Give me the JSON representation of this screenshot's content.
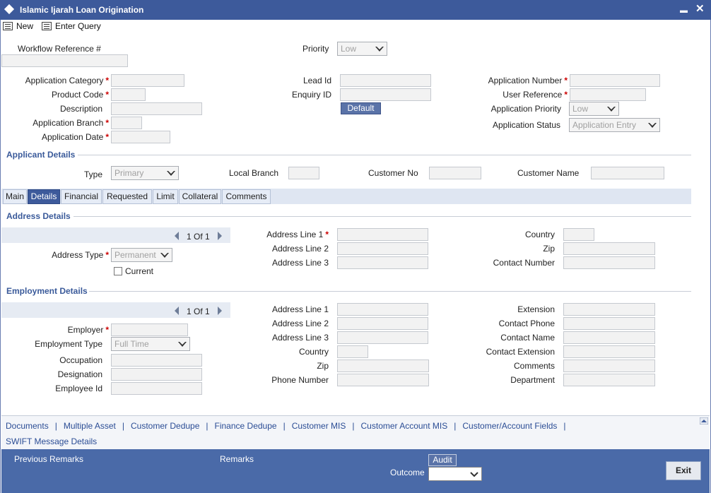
{
  "window": {
    "title": "Islamic Ijarah Loan Origination",
    "minimize": "▬",
    "close": "✕"
  },
  "toolbar": {
    "new_label": "New",
    "enter_query_label": "Enter Query"
  },
  "header": {
    "workflow_ref_label": "Workflow Reference #",
    "priority_label": "Priority",
    "priority_value": "Low",
    "application_category_label": "Application Category",
    "product_code_label": "Product Code",
    "description_label": "Description",
    "application_branch_label": "Application Branch",
    "application_date_label": "Application Date",
    "lead_id_label": "Lead Id",
    "enquiry_id_label": "Enquiry ID",
    "default_button": "Default",
    "application_number_label": "Application Number",
    "user_reference_label": "User Reference",
    "application_priority_label": "Application Priority",
    "application_priority_value": "Low",
    "application_status_label": "Application Status",
    "application_status_value": "Application Entry",
    "required_mark": "*"
  },
  "applicant": {
    "section_title": "Applicant Details",
    "type_label": "Type",
    "type_value": "Primary",
    "local_branch_label": "Local Branch",
    "customer_no_label": "Customer No",
    "customer_name_label": "Customer Name"
  },
  "tabs": [
    {
      "label": "Main"
    },
    {
      "label": "Details"
    },
    {
      "label": "Financial"
    },
    {
      "label": "Requested"
    },
    {
      "label": "Limit"
    },
    {
      "label": "Collateral"
    },
    {
      "label": "Comments"
    }
  ],
  "active_tab": "Details",
  "address": {
    "section_title": "Address Details",
    "pager_text": "1 Of 1",
    "address_type_label": "Address Type",
    "address_type_value": "Permanent",
    "current_label": "Current",
    "address_line1_label": "Address Line 1",
    "address_line2_label": "Address Line 2",
    "address_line3_label": "Address Line 3",
    "country_label": "Country",
    "zip_label": "Zip",
    "contact_number_label": "Contact Number"
  },
  "employment": {
    "section_title": "Employment Details",
    "pager_text": "1 Of 1",
    "employer_label": "Employer",
    "employment_type_label": "Employment Type",
    "employment_type_value": "Full Time",
    "occupation_label": "Occupation",
    "designation_label": "Designation",
    "employee_id_label": "Employee Id",
    "address_line1_label": "Address Line 1",
    "address_line2_label": "Address Line 2",
    "address_line3_label": "Address Line 3",
    "country_label": "Country",
    "zip_label": "Zip",
    "phone_number_label": "Phone Number",
    "extension_label": "Extension",
    "contact_phone_label": "Contact Phone",
    "contact_name_label": "Contact Name",
    "contact_extension_label": "Contact Extension",
    "comments_label": "Comments",
    "department_label": "Department"
  },
  "links": {
    "documents": "Documents",
    "multiple_asset": "Multiple Asset",
    "customer_dedupe": "Customer Dedupe",
    "finance_dedupe": "Finance Dedupe",
    "customer_mis": "Customer MIS",
    "customer_account_mis": "Customer Account MIS",
    "customer_account_fields": "Customer/Account Fields",
    "swift_message_details": "SWIFT Message Details",
    "separator": "|"
  },
  "footer": {
    "previous_remarks_label": "Previous Remarks",
    "remarks_label": "Remarks",
    "audit_button": "Audit",
    "outcome_label": "Outcome",
    "exit_button": "Exit"
  },
  "colors": {
    "title_bar": "#3d5a9b",
    "footer": "#4a6aa8",
    "link": "#2b4d95",
    "required": "#cc0000"
  }
}
